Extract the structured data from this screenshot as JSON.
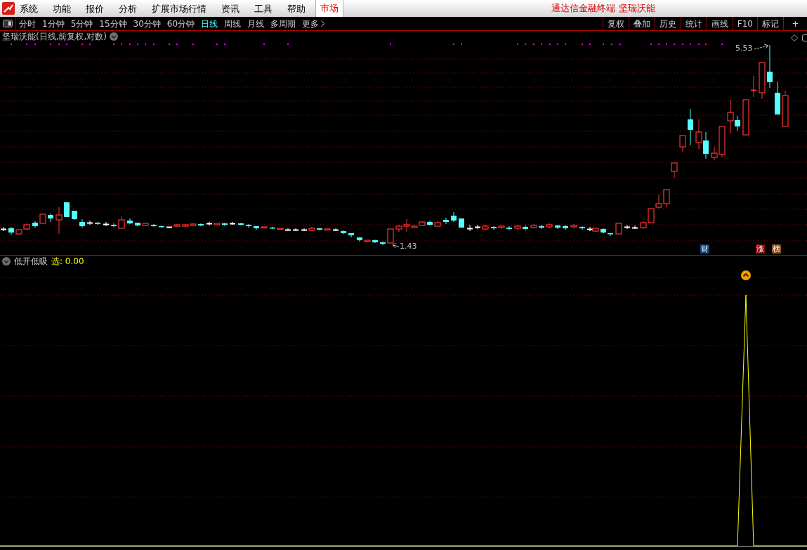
{
  "menu": [
    {
      "label": "系统"
    },
    {
      "label": "功能"
    },
    {
      "label": "报价"
    },
    {
      "label": "分析"
    },
    {
      "label": "扩展市场行情"
    },
    {
      "label": "资讯"
    },
    {
      "label": "工具"
    },
    {
      "label": "帮助"
    }
  ],
  "market_tab": {
    "label": "市场",
    "selected": true
  },
  "window_title": "通达信金融终端 坚瑞沃能",
  "periods": [
    {
      "label": "分时",
      "selected": false
    },
    {
      "label": "1分钟",
      "selected": false
    },
    {
      "label": "5分钟",
      "selected": false
    },
    {
      "label": "15分钟",
      "selected": false
    },
    {
      "label": "30分钟",
      "selected": false
    },
    {
      "label": "60分钟",
      "selected": false
    },
    {
      "label": "日线",
      "selected": true
    },
    {
      "label": "周线",
      "selected": false
    },
    {
      "label": "月线",
      "selected": false
    },
    {
      "label": "多周期",
      "selected": false
    },
    {
      "label": "更多",
      "selected": false
    }
  ],
  "tools": [
    "复权",
    "叠加",
    "历史",
    "统计",
    "画线",
    "F10",
    "标记",
    "+"
  ],
  "chart": {
    "title": "坚瑞沃能(日线,前复权,对数)",
    "high_label": "5.53",
    "low_label": "1.43",
    "markers": [
      {
        "label": "财",
        "color": "#0d3a78"
      },
      {
        "label": "涨",
        "color": "#8c0a0a"
      },
      {
        "label": "榜",
        "color": "#8a4a10"
      }
    ]
  },
  "indicator": {
    "name": "低开低吸",
    "reading": "选: 0.00"
  }
}
